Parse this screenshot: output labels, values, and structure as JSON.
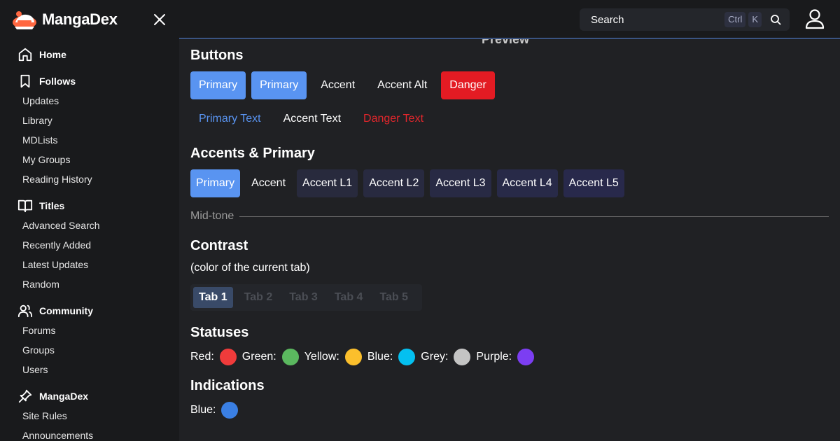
{
  "brand": {
    "name": "MangaDex"
  },
  "sidebar": {
    "sections": [
      {
        "title": "Home",
        "icon": "home-icon",
        "items": []
      },
      {
        "title": "Follows",
        "icon": "bookmark-icon",
        "items": [
          "Updates",
          "Library",
          "MDLists",
          "My Groups",
          "Reading History"
        ]
      },
      {
        "title": "Titles",
        "icon": "book-open-icon",
        "items": [
          "Advanced Search",
          "Recently Added",
          "Latest Updates",
          "Random"
        ]
      },
      {
        "title": "Community",
        "icon": "users-icon",
        "items": [
          "Forums",
          "Groups",
          "Users"
        ]
      },
      {
        "title": "MangaDex",
        "icon": "pin-icon",
        "items": [
          "Site Rules",
          "Announcements"
        ]
      }
    ]
  },
  "topbar": {
    "search_placeholder": "Search",
    "shortcut_ctrl": "Ctrl",
    "shortcut_k": "K"
  },
  "main": {
    "preview_heading": "Preview",
    "buttons": {
      "title": "Buttons",
      "primary1": "Primary",
      "primary2": "Primary",
      "accent": "Accent",
      "accent_alt": "Accent Alt",
      "danger": "Danger",
      "primary_text": "Primary Text",
      "accent_text": "Accent Text",
      "danger_text": "Danger Text"
    },
    "accents": {
      "title": "Accents & Primary",
      "items": [
        "Primary",
        "Accent",
        "Accent L1",
        "Accent L2",
        "Accent L3",
        "Accent L4",
        "Accent L5"
      ]
    },
    "midtone": "Mid-tone",
    "contrast": {
      "title": "Contrast",
      "subtitle": "(color of the current tab)",
      "tabs": [
        "Tab 1",
        "Tab 2",
        "Tab 3",
        "Tab 4",
        "Tab 5"
      ]
    },
    "statuses": {
      "title": "Statuses",
      "items": [
        {
          "label": "Red:",
          "color": "#f03b3b"
        },
        {
          "label": "Green:",
          "color": "#5bb85f"
        },
        {
          "label": "Yellow:",
          "color": "#fbbf2c"
        },
        {
          "label": "Blue:",
          "color": "#04c0f0"
        },
        {
          "label": "Grey:",
          "color": "#c4c4c4"
        },
        {
          "label": "Purple:",
          "color": "#7c3ef2"
        }
      ]
    },
    "indications": {
      "title": "Indications",
      "items": [
        {
          "label": "Blue:",
          "color": "#3a7fe3"
        }
      ]
    }
  }
}
